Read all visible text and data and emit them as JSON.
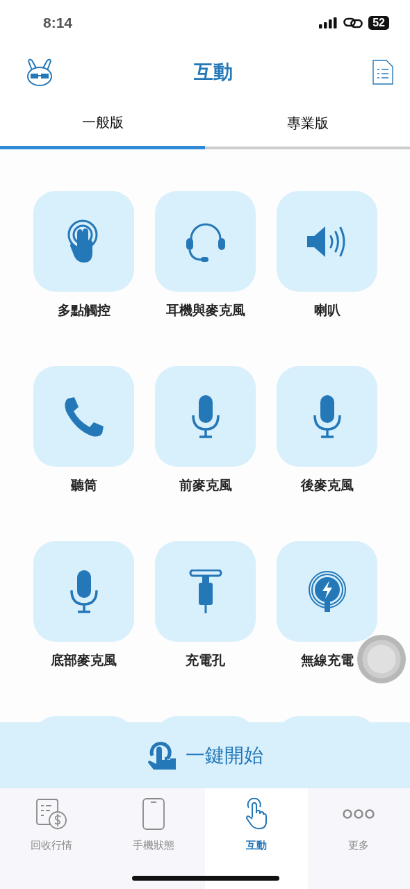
{
  "status_bar": {
    "time": "8:14",
    "battery": "52"
  },
  "header": {
    "title": "互動"
  },
  "tabs": [
    {
      "label": "一般版",
      "selected": true
    },
    {
      "label": "專業版",
      "selected": false
    }
  ],
  "tests": [
    {
      "label": "多點觸控",
      "kind": "touch"
    },
    {
      "label": "耳機與麥克風",
      "kind": "headset"
    },
    {
      "label": "喇叭",
      "kind": "speaker"
    },
    {
      "label": "聽筒",
      "kind": "phone"
    },
    {
      "label": "前麥克風",
      "kind": "mic"
    },
    {
      "label": "後麥克風",
      "kind": "mic"
    },
    {
      "label": "底部麥克風",
      "kind": "mic"
    },
    {
      "label": "充電孔",
      "kind": "port"
    },
    {
      "label": "無線充電",
      "kind": "wireless"
    }
  ],
  "start_button": {
    "label": "一鍵開始"
  },
  "bottom_nav": [
    {
      "label": "回收行情",
      "kind": "price",
      "selected": false
    },
    {
      "label": "手機狀態",
      "kind": "phone",
      "selected": false
    },
    {
      "label": "互動",
      "kind": "touch",
      "selected": true
    },
    {
      "label": "更多",
      "kind": "more",
      "selected": false
    }
  ]
}
